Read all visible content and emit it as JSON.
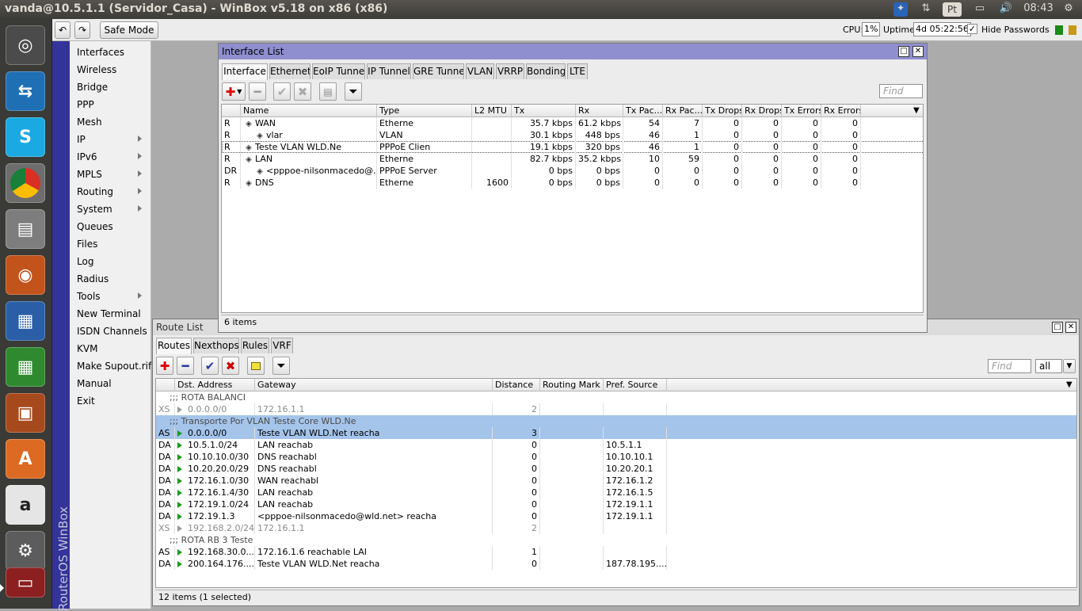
{
  "topbar": {
    "title": "vanda@10.5.1.1 (Servidor_Casa) - WinBox v5.18 on x86 (x86)",
    "lang": "Pt",
    "time": "08:43"
  },
  "toolbar": {
    "safe_mode": "Safe Mode",
    "cpu_label": "CPU:",
    "cpu_value": "1%",
    "uptime_label": "Uptime:",
    "uptime_value": "4d 05:22:56",
    "hide_passwords": "Hide Passwords"
  },
  "brand": "RouterOS WinBox",
  "menu": [
    "Interfaces",
    "Wireless",
    "Bridge",
    "PPP",
    "Mesh",
    "IP",
    "IPv6",
    "MPLS",
    "Routing",
    "System",
    "Queues",
    "Files",
    "Log",
    "Radius",
    "Tools",
    "New Terminal",
    "ISDN Channels",
    "KVM",
    "Make Supout.rif",
    "Manual",
    "Exit"
  ],
  "interface_list": {
    "title": "Interface List",
    "tabs": [
      "Interface",
      "Ethernet",
      "EoIP Tunnel",
      "IP Tunnel",
      "GRE Tunnel",
      "VLAN",
      "VRRP",
      "Bonding",
      "LTE"
    ],
    "find": "Find",
    "columns": [
      "Name",
      "Type",
      "L2 MTU",
      "Tx",
      "Rx",
      "Tx Pac...",
      "Rx Pac...",
      "Tx Drops",
      "Rx Drops",
      "Tx Errors",
      "Rx Errors"
    ],
    "rows": [
      {
        "flag": "R",
        "name": "WAN",
        "type": "Etherne",
        "mtu": "",
        "tx": "35.7 kbps",
        "rx": "61.2 kbps",
        "txp": "54",
        "rxp": "7",
        "txd": "0",
        "rxd": "0",
        "txe": "0",
        "rxe": "0"
      },
      {
        "flag": "R",
        "name": "vlar",
        "type": "VLAN",
        "mtu": "",
        "tx": "30.1 kbps",
        "rx": "448 bps",
        "txp": "46",
        "rxp": "1",
        "txd": "0",
        "rxd": "0",
        "txe": "0",
        "rxe": "0"
      },
      {
        "flag": "R",
        "name": "Teste VLAN WLD.Ne",
        "type": "PPPoE Clien",
        "mtu": "",
        "tx": "19.1 kbps",
        "rx": "320 bps",
        "txp": "46",
        "rxp": "1",
        "txd": "0",
        "rxd": "0",
        "txe": "0",
        "rxe": "0"
      },
      {
        "flag": "R",
        "name": "LAN",
        "type": "Etherne",
        "mtu": "",
        "tx": "82.7 kbps",
        "rx": "35.2 kbps",
        "txp": "10",
        "rxp": "59",
        "txd": "0",
        "rxd": "0",
        "txe": "0",
        "rxe": "0"
      },
      {
        "flag": "DR",
        "name": "<pppoe-nilsonmacedo@.",
        "type": "PPPoE Server",
        "mtu": "",
        "tx": "0 bps",
        "rx": "0 bps",
        "txp": "0",
        "rxp": "0",
        "txd": "0",
        "rxd": "0",
        "txe": "0",
        "rxe": "0"
      },
      {
        "flag": "R",
        "name": "DNS",
        "type": "Etherne",
        "mtu": "1600",
        "tx": "0 bps",
        "rx": "0 bps",
        "txp": "0",
        "rxp": "0",
        "txd": "0",
        "rxd": "0",
        "txe": "0",
        "rxe": "0"
      }
    ],
    "status": "6 items"
  },
  "route_list": {
    "title": "Route List",
    "tabs": [
      "Routes",
      "Nexthops",
      "Rules",
      "VRF"
    ],
    "find": "Find",
    "filter": "all",
    "columns": [
      "Dst. Address",
      "Gateway",
      "Distance",
      "Routing Mark",
      "Pref. Source"
    ],
    "rows": [
      {
        "kind": "comment",
        "text": ";;; ROTA BALANCI"
      },
      {
        "kind": "route",
        "flag": "XS",
        "dst": "0.0.0.0/0",
        "gw": "172.16.1.1",
        "dist": "2",
        "mark": "",
        "pref": "",
        "state": "disabled"
      },
      {
        "kind": "comment",
        "text": ";;; Transporte Por VLAN Teste Core WLD.Ne",
        "state": "selected"
      },
      {
        "kind": "route",
        "flag": "AS",
        "dst": "0.0.0.0/0",
        "gw": "Teste VLAN WLD.Net reacha",
        "dist": "3",
        "mark": "",
        "pref": "",
        "state": "selected"
      },
      {
        "kind": "route",
        "flag": "DA",
        "dst": "10.5.1.0/24",
        "gw": "LAN reachab",
        "dist": "0",
        "mark": "",
        "pref": "10.5.1.1"
      },
      {
        "kind": "route",
        "flag": "DA",
        "dst": "10.10.10.0/30",
        "gw": "DNS reachabl",
        "dist": "0",
        "mark": "",
        "pref": "10.10.10.1"
      },
      {
        "kind": "route",
        "flag": "DA",
        "dst": "10.20.20.0/29",
        "gw": "DNS reachabl",
        "dist": "0",
        "mark": "",
        "pref": "10.20.20.1"
      },
      {
        "kind": "route",
        "flag": "DA",
        "dst": "172.16.1.0/30",
        "gw": "WAN reachabl",
        "dist": "0",
        "mark": "",
        "pref": "172.16.1.2"
      },
      {
        "kind": "route",
        "flag": "DA",
        "dst": "172.16.1.4/30",
        "gw": "LAN reachab",
        "dist": "0",
        "mark": "",
        "pref": "172.16.1.5"
      },
      {
        "kind": "route",
        "flag": "DA",
        "dst": "172.19.1.0/24",
        "gw": "LAN reachab",
        "dist": "0",
        "mark": "",
        "pref": "172.19.1.1"
      },
      {
        "kind": "route",
        "flag": "DA",
        "dst": "172.19.1.3",
        "gw": "<pppoe-nilsonmacedo@wld.net> reacha",
        "dist": "0",
        "mark": "",
        "pref": "172.19.1.1"
      },
      {
        "kind": "route",
        "flag": "XS",
        "dst": "192.168.2.0/24",
        "gw": "172.16.1.1",
        "dist": "2",
        "mark": "",
        "pref": "",
        "state": "disabled"
      },
      {
        "kind": "comment",
        "text": ";;; ROTA RB 3 Teste"
      },
      {
        "kind": "route",
        "flag": "AS",
        "dst": "192.168.30.0...",
        "gw": "172.16.1.6 reachable LAI",
        "dist": "1",
        "mark": "",
        "pref": ""
      },
      {
        "kind": "route",
        "flag": "DA",
        "dst": "200.164.176....",
        "gw": "Teste VLAN WLD.Net reacha",
        "dist": "0",
        "mark": "",
        "pref": "187.78.195...."
      }
    ],
    "status": "12 items (1 selected)"
  },
  "colors": {
    "winbox_blue": "#333399",
    "selected_row": "#a4c4ea",
    "title_blue": "#8f8fcf"
  }
}
